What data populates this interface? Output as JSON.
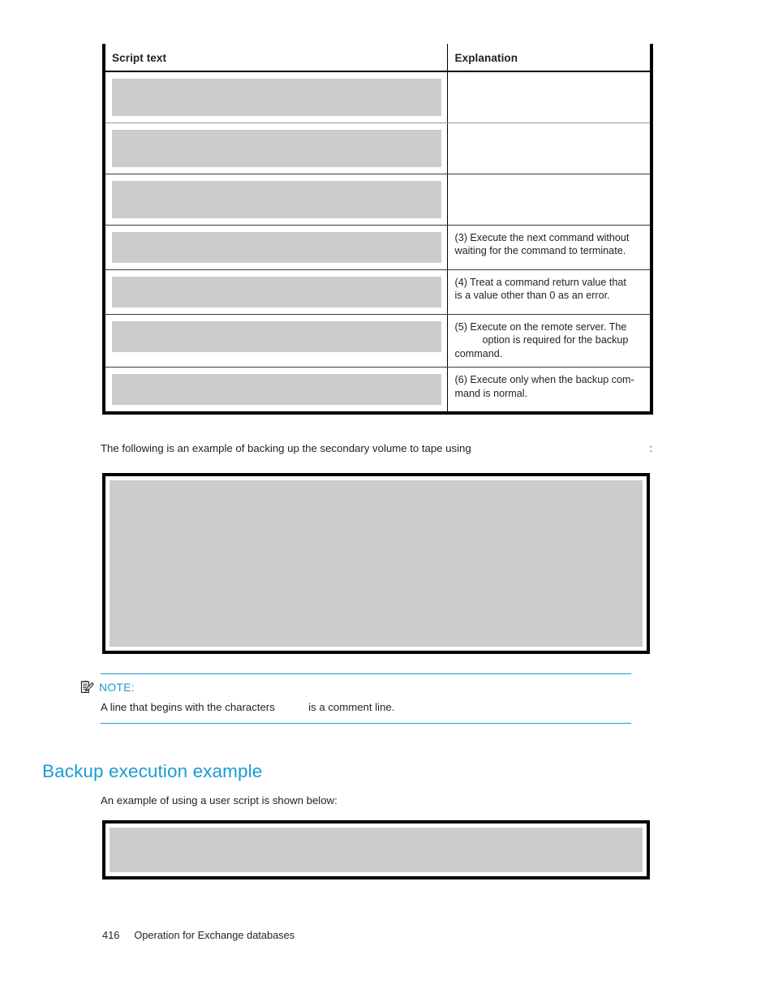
{
  "table": {
    "headers": {
      "script": "Script text",
      "explanation": "Explanation"
    },
    "rows": [
      {
        "script_redacted": true,
        "script_height": 46,
        "explanation_lines": []
      },
      {
        "script_redacted": true,
        "script_height": 46,
        "explanation_lines": []
      },
      {
        "script_redacted": true,
        "script_height": 46,
        "explanation_lines": []
      },
      {
        "script_redacted": true,
        "script_height": 38,
        "explanation_lines": [
          {
            "text": "(3) Execute the next command without",
            "indent": false
          },
          {
            "text": "waiting for the command to terminate.",
            "indent": false
          }
        ]
      },
      {
        "script_redacted": true,
        "script_height": 38,
        "explanation_lines": [
          {
            "text": "(4) Treat a command return value that",
            "indent": false
          },
          {
            "text": "is a value other than 0 as an error.",
            "indent": false
          }
        ]
      },
      {
        "script_redacted": true,
        "script_height": 38,
        "explanation_lines": [
          {
            "text": "(5) Execute on the remote server. The",
            "indent": false
          },
          {
            "text": "option is required for the backup",
            "indent": true
          },
          {
            "text": "command.",
            "indent": false
          }
        ]
      },
      {
        "script_redacted": true,
        "script_height": 38,
        "explanation_lines": [
          {
            "text": "(6) Execute only when the backup com-",
            "indent": false
          },
          {
            "text": "mand is normal.",
            "indent": false
          }
        ]
      }
    ]
  },
  "intro_paragraph": {
    "text_before_gap": "The following is an example of backing up the secondary volume to tape using",
    "text_after_gap": "",
    "trailing": ":"
  },
  "code_blocks": {
    "main_redacted": true,
    "execution_redacted": true
  },
  "note": {
    "icon": "note-document-pencil-icon",
    "label": "NOTE:",
    "body_before_gap": "A line that begins with the characters",
    "body_after_gap": "is a comment line."
  },
  "heading": {
    "text": "Backup execution example"
  },
  "example_paragraph": {
    "text": "An example of using a user script is shown below:"
  },
  "footer": {
    "page_number": "416",
    "chapter_title": "Operation for Exchange databases"
  },
  "colors": {
    "accent_blue": "#1b9ad6",
    "redaction_gray": "#cccccc",
    "body_text": "#231f20"
  }
}
